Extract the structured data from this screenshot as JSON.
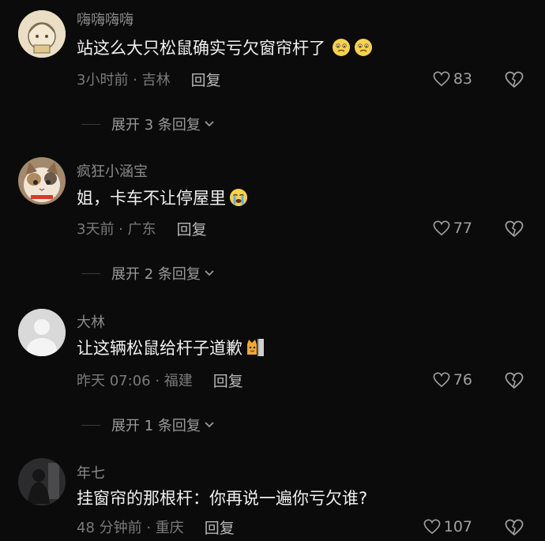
{
  "comments": [
    {
      "username": "嗨嗨嗨嗨",
      "text": "站这么大只松鼠确实亏欠窗帘杆了",
      "time_location": "3小时前 · 吉林",
      "reply_label": "回复",
      "likes": "83",
      "expand_label": "展开 3 条回复"
    },
    {
      "username": "疯狂小涵宝",
      "text": "姐，卡车不让停屋里",
      "time_location": "3天前 · 广东",
      "reply_label": "回复",
      "likes": "77",
      "expand_label": "展开 2 条回复"
    },
    {
      "username": "大林",
      "text": "让这辆松鼠给杆子道歉",
      "time_location": "昨天 07:06 · 福建",
      "reply_label": "回复",
      "likes": "76",
      "expand_label": "展开 1 条回复"
    },
    {
      "username": "年七",
      "text": "挂窗帘的那根杆：你再说一遍你亏欠谁?",
      "time_location": "48 分钟前 · 重庆",
      "reply_label": "回复",
      "likes": "107"
    }
  ],
  "icons": {
    "like": "heart-outline-icon",
    "dislike": "broken-heart-icon",
    "expand": "chevron-down-icon"
  },
  "colors": {
    "background": "#0b0b0b",
    "username": "#8a8a8a",
    "content": "#f0f0f0",
    "meta": "#7a7a7a"
  }
}
